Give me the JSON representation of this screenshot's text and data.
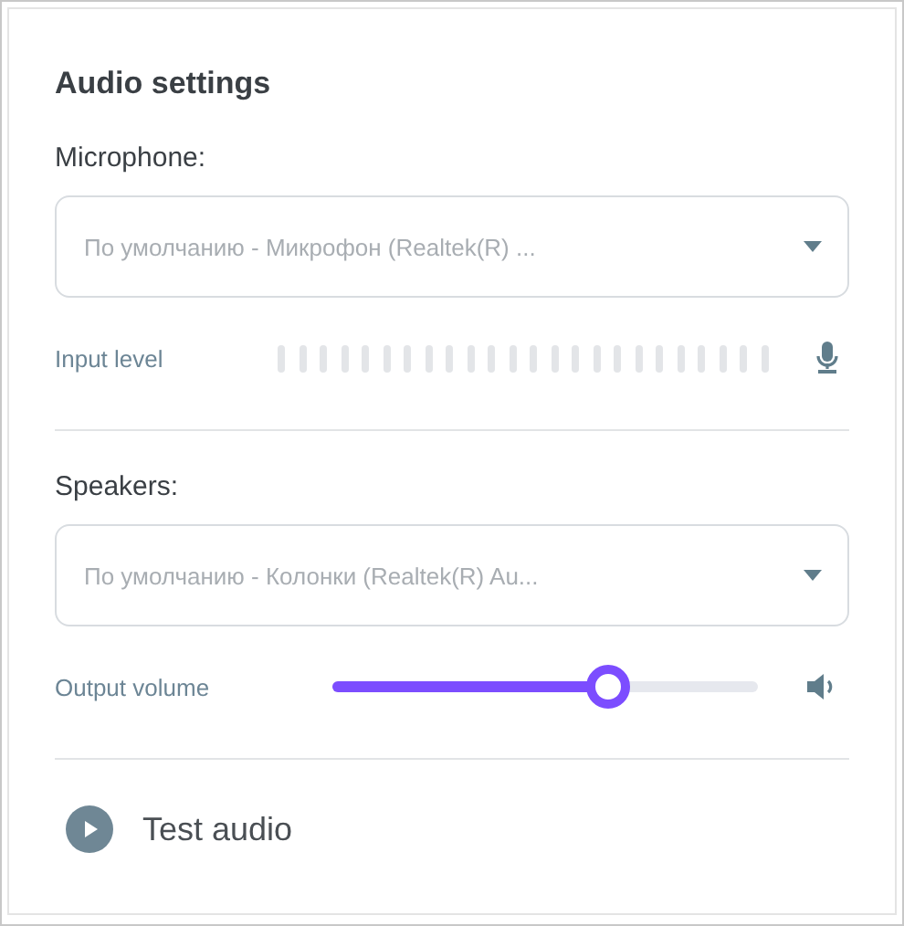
{
  "title": "Audio settings",
  "microphone": {
    "label": "Microphone:",
    "value": "По умолчанию - Микрофон (Realtek(R) ...",
    "meter_label": "Input level"
  },
  "speakers": {
    "label": "Speakers:",
    "value": "По умолчанию - Колонки (Realtek(R) Au...",
    "slider_label": "Output volume",
    "level": 0.65
  },
  "test_button": "Test audio"
}
